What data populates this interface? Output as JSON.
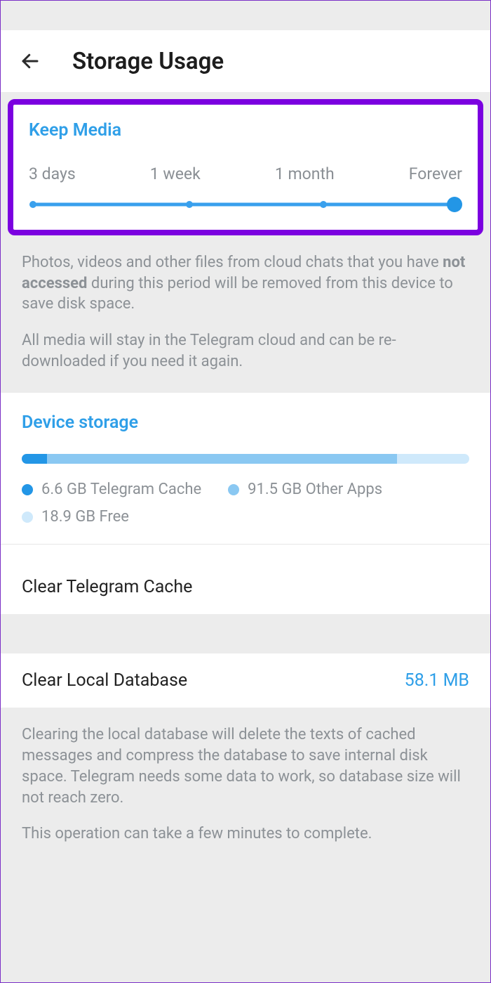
{
  "header": {
    "title": "Storage Usage"
  },
  "keep_media": {
    "title": "Keep Media",
    "options": [
      "3 days",
      "1 week",
      "1 month",
      "Forever"
    ],
    "selected_index": 3
  },
  "keep_media_help": {
    "p1_before": "Photos, videos and other files from cloud chats that you have ",
    "p1_bold": "not accessed",
    "p1_after": " during this period will be removed from this device to save disk space.",
    "p2": "All media will stay in the Telegram cloud and can be re-downloaded if you need it again."
  },
  "device_storage": {
    "title": "Device storage",
    "segments": [
      {
        "label": "6.6 GB Telegram Cache",
        "gb": 6.6,
        "color": "c1"
      },
      {
        "label": "91.5 GB Other Apps",
        "gb": 91.5,
        "color": "c2"
      },
      {
        "label": "18.9 GB Free",
        "gb": 18.9,
        "color": "c3"
      }
    ]
  },
  "clear_cache": {
    "label": "Clear Telegram Cache"
  },
  "clear_db": {
    "label": "Clear Local Database",
    "value": "58.1 MB"
  },
  "clear_db_help": {
    "p1": "Clearing the local database will delete the texts of cached messages and compress the database to save internal disk space. Telegram needs some data to work, so database size will not reach zero.",
    "p2": "This operation can take a few minutes to complete."
  }
}
